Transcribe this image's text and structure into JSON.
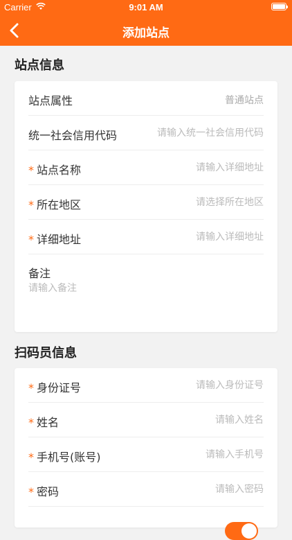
{
  "status_bar": {
    "carrier": "Carrier",
    "time": "9:01 AM"
  },
  "nav": {
    "title": "添加站点"
  },
  "station_section": {
    "title": "站点信息",
    "rows": [
      {
        "label": "站点属性",
        "value": "普通站点",
        "required": false
      },
      {
        "label": "统一社会信用代码",
        "placeholder": "请输入统一社会信用代码",
        "required": false
      },
      {
        "label": "站点名称",
        "placeholder": "请输入详细地址",
        "required": true
      },
      {
        "label": "所在地区",
        "placeholder": "请选择所在地区",
        "required": true
      },
      {
        "label": "详细地址",
        "placeholder": "请输入详细地址",
        "required": true
      }
    ],
    "remark": {
      "label": "备注",
      "placeholder": "请输入备注"
    }
  },
  "scanner_section": {
    "title": "扫码员信息",
    "rows": [
      {
        "label": "身份证号",
        "placeholder": "请输入身份证号",
        "required": true
      },
      {
        "label": "姓名",
        "placeholder": "请输入姓名",
        "required": true
      },
      {
        "label": "手机号(账号)",
        "placeholder": "请输入手机号",
        "required": true
      },
      {
        "label": "密码",
        "placeholder": "请输入密码",
        "required": true
      }
    ]
  },
  "required_mark": "*",
  "colors": {
    "accent": "#ff6a14",
    "background": "#f2f2f2"
  },
  "icons": {
    "back": "chevron-left-icon",
    "wifi": "wifi-icon",
    "battery": "battery-icon"
  }
}
